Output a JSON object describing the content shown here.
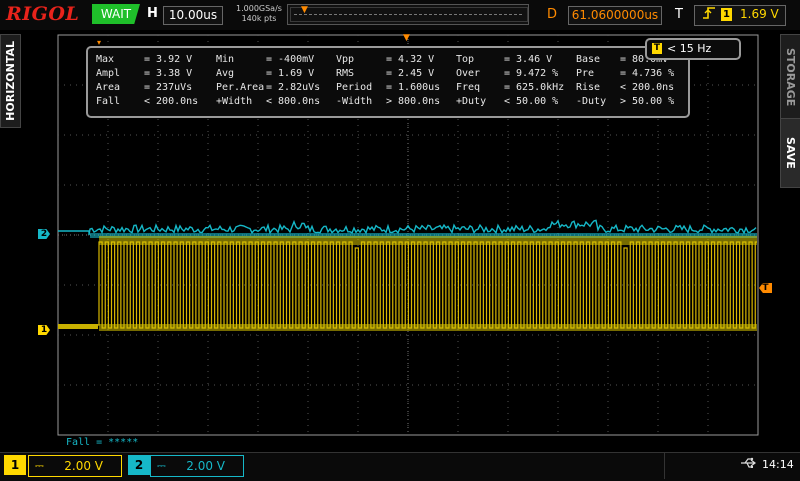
{
  "brand": "RIGOL",
  "run_status": "WAIT",
  "horizontal": {
    "label": "H",
    "scale": "10.00us"
  },
  "acquisition": {
    "sample_rate": "1.000GSa/s",
    "memory_depth": "140k pts"
  },
  "delay": {
    "label": "D",
    "value": "61.0600000us"
  },
  "trigger": {
    "label": "T",
    "slope_icon": "rising-edge-icon",
    "source": "1",
    "level": "1.69 V"
  },
  "side_tabs": {
    "horizontal": "HORIZONTAL",
    "storage": "STORAGE",
    "save": "SAVE"
  },
  "frequency_counter": {
    "icon": "T",
    "value": "< 15 Hz"
  },
  "measurements": [
    [
      {
        "name": "Max",
        "value": "= 3.92 V"
      },
      {
        "name": "Min",
        "value": "= -400mV"
      },
      {
        "name": "Vpp",
        "value": "= 4.32 V"
      },
      {
        "name": "Top",
        "value": "= 3.46 V"
      },
      {
        "name": "Base",
        "value": "= 80.0mV"
      }
    ],
    [
      {
        "name": "Ampl",
        "value": "= 3.38 V"
      },
      {
        "name": "Avg",
        "value": "= 1.69 V"
      },
      {
        "name": "RMS",
        "value": "= 2.45 V"
      },
      {
        "name": "Over",
        "value": "= 9.472 %"
      },
      {
        "name": "Pre",
        "value": "= 4.736 %"
      }
    ],
    [
      {
        "name": "Area",
        "value": "= 237uVs"
      },
      {
        "name": "Per.Area",
        "value": "= 2.82uVs"
      },
      {
        "name": "Period",
        "value": "= 1.600us"
      },
      {
        "name": "Freq",
        "value": "= 625.0kHz"
      },
      {
        "name": "Rise",
        "value": "< 200.0ns"
      }
    ],
    [
      {
        "name": "Fall",
        "value": "< 200.0ns"
      },
      {
        "name": "+Width",
        "value": "< 800.0ns"
      },
      {
        "name": "-Width",
        "value": "> 800.0ns"
      },
      {
        "name": "+Duty",
        "value": "< 50.00 %"
      },
      {
        "name": "-Duty",
        "value": "> 50.00 %"
      }
    ]
  ],
  "channel_markers": {
    "ch1": "1",
    "ch2": "2",
    "trigger_level": "T"
  },
  "fall_statistic": "Fall = *****",
  "channels": [
    {
      "number": "1",
      "coupling": "⎓",
      "scale": "2.00 V",
      "color": "#ffd800"
    },
    {
      "number": "2",
      "coupling": "⎓",
      "scale": "2.00 V",
      "color": "#16b8c8"
    }
  ],
  "status": {
    "usb_icon": "usb-icon",
    "time": "14:14"
  },
  "colors": {
    "ch1": "#ffd800",
    "ch2": "#16b8c8",
    "trigger": "#ff8a00",
    "brand": "#e8231b",
    "wait": "#1fbf2a"
  }
}
